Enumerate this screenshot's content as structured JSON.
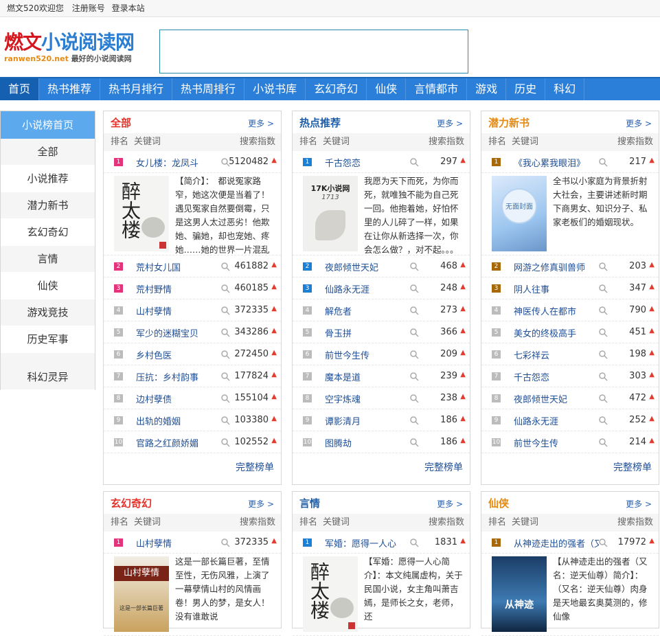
{
  "topbar": {
    "welcome": "燃文520欢迎您",
    "register": "注册账号",
    "login": "登录本站"
  },
  "logo": {
    "part1": "燃文",
    "part2": "小说阅读网",
    "domain": "ranwen520.net",
    "slogan": "最好的小说阅读网"
  },
  "nav": [
    "首页",
    "热书推荐",
    "热书月排行",
    "热书周排行",
    "小说书库",
    "玄幻奇幻",
    "仙侠",
    "言情都市",
    "游戏",
    "历史",
    "科幻"
  ],
  "sidebar": {
    "head": "小说榜首页",
    "items": [
      "全部",
      "小说推荐",
      "潜力新书",
      "玄幻奇幻",
      "言情",
      "仙侠",
      "游戏竞技",
      "历史军事",
      "科幻灵异"
    ]
  },
  "colors": {
    "red_title": "#e4332a",
    "blue_title": "#1f5ea8",
    "orange_title": "#e58a12"
  },
  "common": {
    "more": "更多",
    "col_rank": "排名",
    "col_kw": "关键词",
    "col_index": "搜索指数",
    "full": "完整榜单"
  },
  "boxes": [
    {
      "title": "全部",
      "color": "red",
      "feature": {
        "name": "女儿楼：龙凤斗",
        "num": "5120482",
        "desc": "【简介】：　都说冤家路窄，她这次便是当着了！遇见冤家自然要倒霉，只是这男人太过恶劣！他欺她、骗她，却也宠她、疼她……她的世界一片混乱的时候一场"
      },
      "rows": [
        [
          "2",
          "荒村女儿国",
          "461882"
        ],
        [
          "3",
          "荒村野情",
          "460185"
        ],
        [
          "4",
          "山村孽情",
          "372335"
        ],
        [
          "5",
          "军少的迷糊宝贝",
          "343286"
        ],
        [
          "6",
          "乡村色医",
          "272450"
        ],
        [
          "7",
          "压抗：乡村韵事",
          "177824"
        ],
        [
          "8",
          "边村孽债",
          "155104"
        ],
        [
          "9",
          "出轨的婚姻",
          "103380"
        ],
        [
          "10",
          "官路之红颜娇媚",
          "102552"
        ]
      ]
    },
    {
      "title": "热点推荐",
      "color": "blue",
      "feature": {
        "name": "千古怨恋",
        "num": "297",
        "desc": "我愿为天下而死，为你而死，就唯独不能为自己死一回。他抱着她，好怕怀里的人儿碎了一样，如果在让你从新选择一次，你会怎么做？，对不起。。。"
      },
      "rows": [
        [
          "2",
          "夜郎倾世天妃",
          "468"
        ],
        [
          "3",
          "仙路永无涯",
          "248"
        ],
        [
          "4",
          "解危者",
          "273"
        ],
        [
          "5",
          "骨玉拼",
          "366"
        ],
        [
          "6",
          "前世今生传",
          "209"
        ],
        [
          "7",
          "魔本是道",
          "239"
        ],
        [
          "8",
          "空宇炼魂",
          "238"
        ],
        [
          "9",
          "谭影清月",
          "186"
        ],
        [
          "10",
          "图腾劫",
          "186"
        ]
      ]
    },
    {
      "title": "潜力新书",
      "color": "orange",
      "feature": {
        "name": "《我心累我眼泪》",
        "num": "217",
        "desc": "全书以小家庭为背景折射大社会，主要讲述新时期下商男女、知识分子、私家老板们的婚姻现状。"
      },
      "rows": [
        [
          "2",
          "网游之修真驯兽师",
          "203"
        ],
        [
          "3",
          "阴人往事",
          "347"
        ],
        [
          "4",
          "神医传人在都市",
          "790"
        ],
        [
          "5",
          "美女的终极高手",
          "451"
        ],
        [
          "6",
          "七彩祥云",
          "198"
        ],
        [
          "7",
          "千古怨恋",
          "303"
        ],
        [
          "8",
          "夜郎倾世天妃",
          "472"
        ],
        [
          "9",
          "仙路永无涯",
          "252"
        ],
        [
          "10",
          "前世今生传",
          "214"
        ]
      ]
    },
    {
      "title": "玄幻奇幻",
      "color": "red",
      "feature": {
        "name": "山村孽情",
        "num": "372335",
        "desc": "这是一部长篇巨著，至情至性，无伤风雅，上演了一幕孽情山村的风情画卷！男人的梦，是女人！没有谁敢说"
      },
      "rows": []
    },
    {
      "title": "言情",
      "color": "blue",
      "feature": {
        "name": "军婚：愿得一人心",
        "num": "1831",
        "desc": "【军婚：愿得一人心简介】：本文纯属虚构，关于民国小说，女主角叫萧吉嫣，是师长之女，老师，还"
      },
      "rows": []
    },
    {
      "title": "仙侠",
      "color": "orange",
      "feature": {
        "name": "从神迹走出的强者（又",
        "num": "17972",
        "desc": "【从神迹走出的强者（又名：逆天仙尊）简介】：（又名：逆天仙尊）肉身是天地最玄奥莫测的，修仙像"
      },
      "rows": []
    }
  ],
  "covers": {
    "c1": "醉太楼",
    "c2": "17K小说网",
    "c2sub": "1713",
    "c3": "无面封面",
    "c4": "山村孽情",
    "c4sub": "这是一部长篇巨著",
    "c5": "醉太楼",
    "c6": "从神迹"
  }
}
